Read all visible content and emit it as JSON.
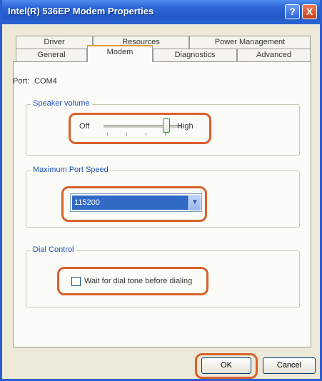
{
  "window": {
    "title": "Intel(R) 536EP Modem Properties",
    "help_label": "?",
    "close_label": "X"
  },
  "tabs": {
    "row_back": [
      "Driver",
      "Resources",
      "Power Management"
    ],
    "row_front": [
      "General",
      "Modem",
      "Diagnostics",
      "Advanced"
    ],
    "active": "Modem"
  },
  "port": {
    "label": "Port:",
    "value": "COM4"
  },
  "speaker_volume": {
    "title": "Speaker volume",
    "min_label": "Off",
    "max_label": "High",
    "level": 0.8
  },
  "max_port_speed": {
    "title": "Maximum Port Speed",
    "selected": "115200"
  },
  "dial_control": {
    "title": "Dial Control",
    "checkbox_label": "Wait for dial tone before dialing",
    "checked": false
  },
  "buttons": {
    "ok": "OK",
    "cancel": "Cancel"
  },
  "colors": {
    "titlebar": "#2159c8",
    "highlight_ring": "#d9602a",
    "selection": "#316ac5",
    "group_title": "#1f4fb7"
  }
}
